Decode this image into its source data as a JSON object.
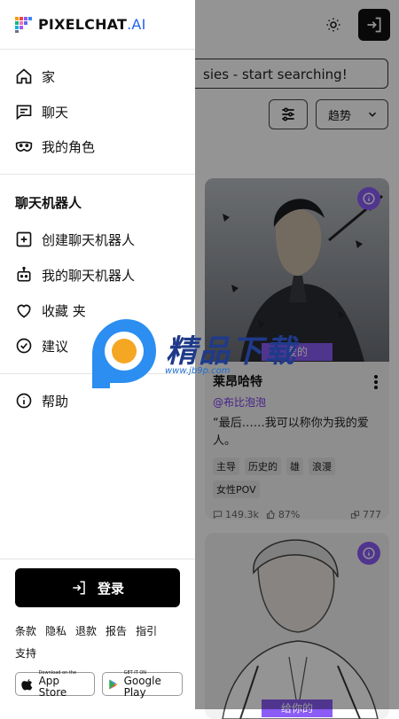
{
  "header": {
    "theme_icon": "sun-icon",
    "login_icon": "login-icon"
  },
  "search": {
    "text": "sies - start searching!"
  },
  "sort": {
    "label": "趋势"
  },
  "cards": [
    {
      "ribbon": "爱的",
      "title": "莱昂哈特",
      "author": "@布比泡泡",
      "description": "“最后……我可以称你为我的爱人。",
      "tags": [
        "主导",
        "历史的",
        "雄",
        "浪漫",
        "女性POV"
      ],
      "stats": {
        "messages": "149.3k",
        "likes": "87%",
        "count": "777"
      }
    },
    {
      "ribbon": "给你的"
    }
  ],
  "drawer": {
    "logo": {
      "main": "PIXELCHAT",
      "suffix": ".AI"
    },
    "nav": [
      {
        "label": "家",
        "icon": "home-icon"
      },
      {
        "label": "聊天",
        "icon": "chat-icon"
      },
      {
        "label": "我的角色",
        "icon": "mask-icon"
      }
    ],
    "section_title": "聊天机器人",
    "bot_nav": [
      {
        "label": "创建聊天机器人",
        "icon": "plus-square-icon"
      },
      {
        "label": "我的聊天机器人",
        "icon": "bot-icon"
      },
      {
        "label": "收藏 夹",
        "icon": "heart-icon"
      },
      {
        "label": "建议",
        "icon": "check-circle-icon"
      }
    ],
    "help": {
      "label": "帮助",
      "icon": "info-icon"
    },
    "login_button": "登录",
    "footer_links": [
      "条款",
      "隐私",
      "退款",
      "报告",
      "指引",
      "支持"
    ],
    "app_store": {
      "small": "Download on the",
      "big": "App Store"
    },
    "google_play": {
      "small": "GET IT ON",
      "big": "Google Play"
    }
  },
  "watermark": {
    "text": "精品下载",
    "url": "www.jb9p.com"
  }
}
